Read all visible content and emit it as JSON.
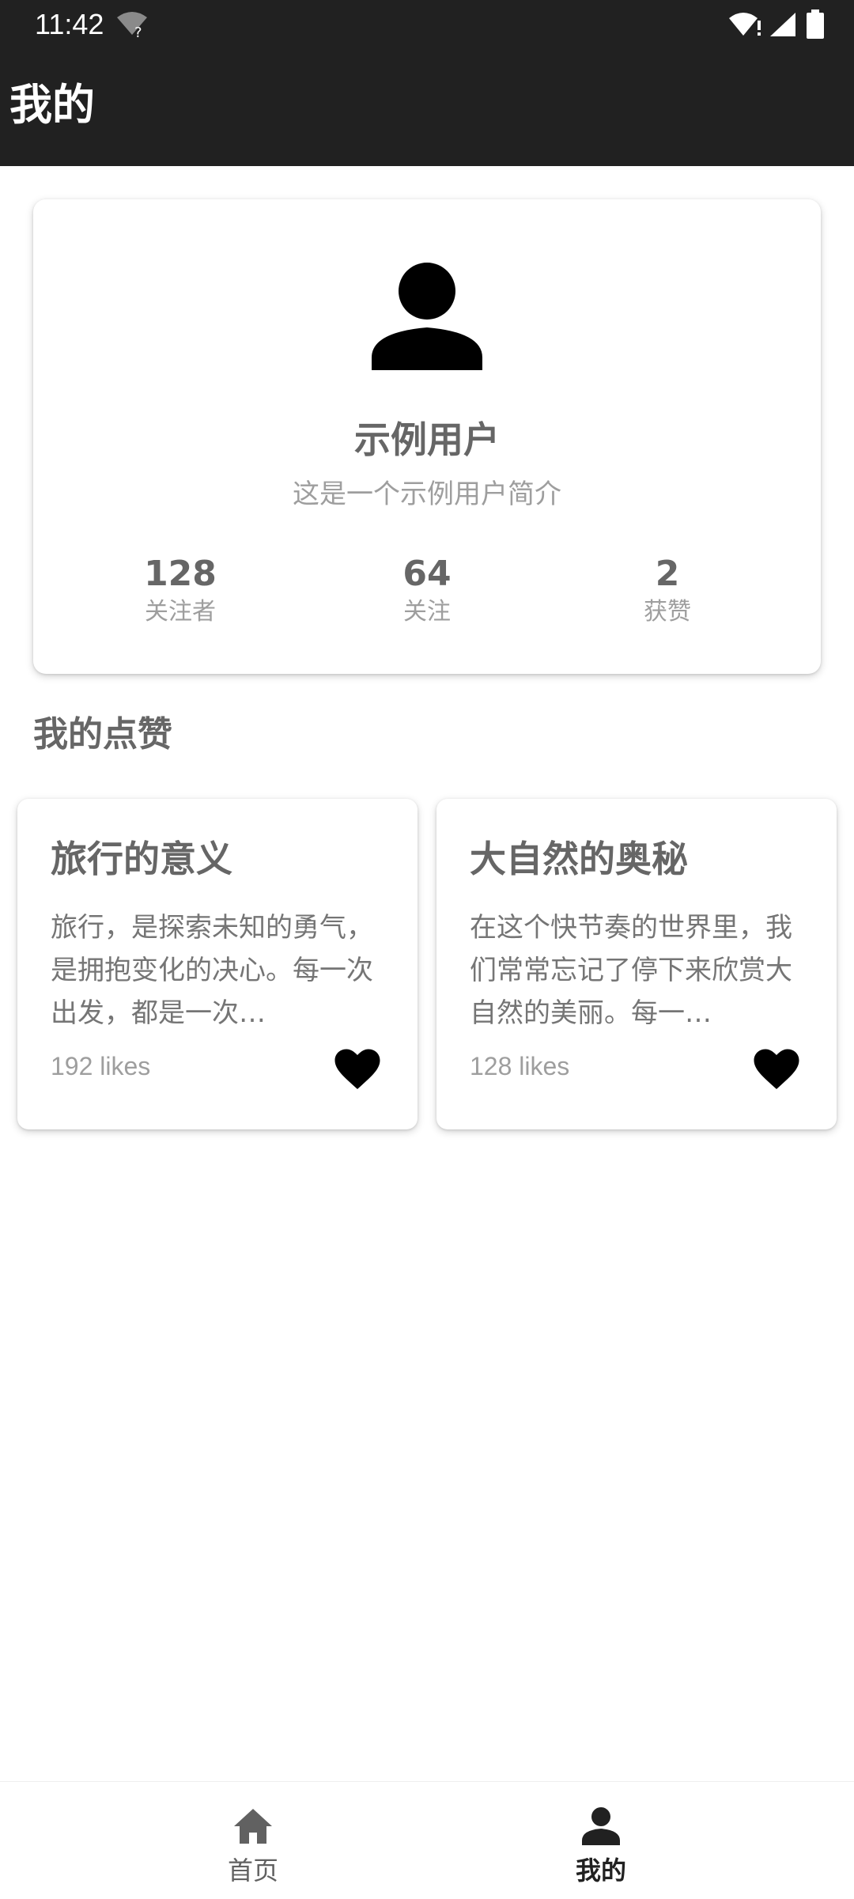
{
  "status_bar": {
    "time": "11:42"
  },
  "app_bar": {
    "title": "我的"
  },
  "profile": {
    "name": "示例用户",
    "bio": "这是一个示例用户简介",
    "stats": [
      {
        "value": "128",
        "label": "关注者"
      },
      {
        "value": "64",
        "label": "关注"
      },
      {
        "value": "2",
        "label": "获赞"
      }
    ]
  },
  "liked_section": {
    "title": "我的点赞",
    "items": [
      {
        "title": "旅行的意义",
        "excerpt": "旅行，是探索未知的勇气，是拥抱变化的决心。每一次出发，都是一次…",
        "likes": "192 likes"
      },
      {
        "title": "大自然的奥秘",
        "excerpt": "在这个快节奏的世界里，我们常常忘记了停下来欣赏大自然的美丽。每一…",
        "likes": "128 likes"
      }
    ]
  },
  "bottom_nav": {
    "items": [
      {
        "label": "首页",
        "icon": "home-icon",
        "active": false
      },
      {
        "label": "我的",
        "icon": "person-icon",
        "active": true
      }
    ]
  },
  "colors": {
    "app_bar": "#212121",
    "card_title": "#666666",
    "muted_text": "#9e9e9e",
    "heart": "#000000"
  }
}
